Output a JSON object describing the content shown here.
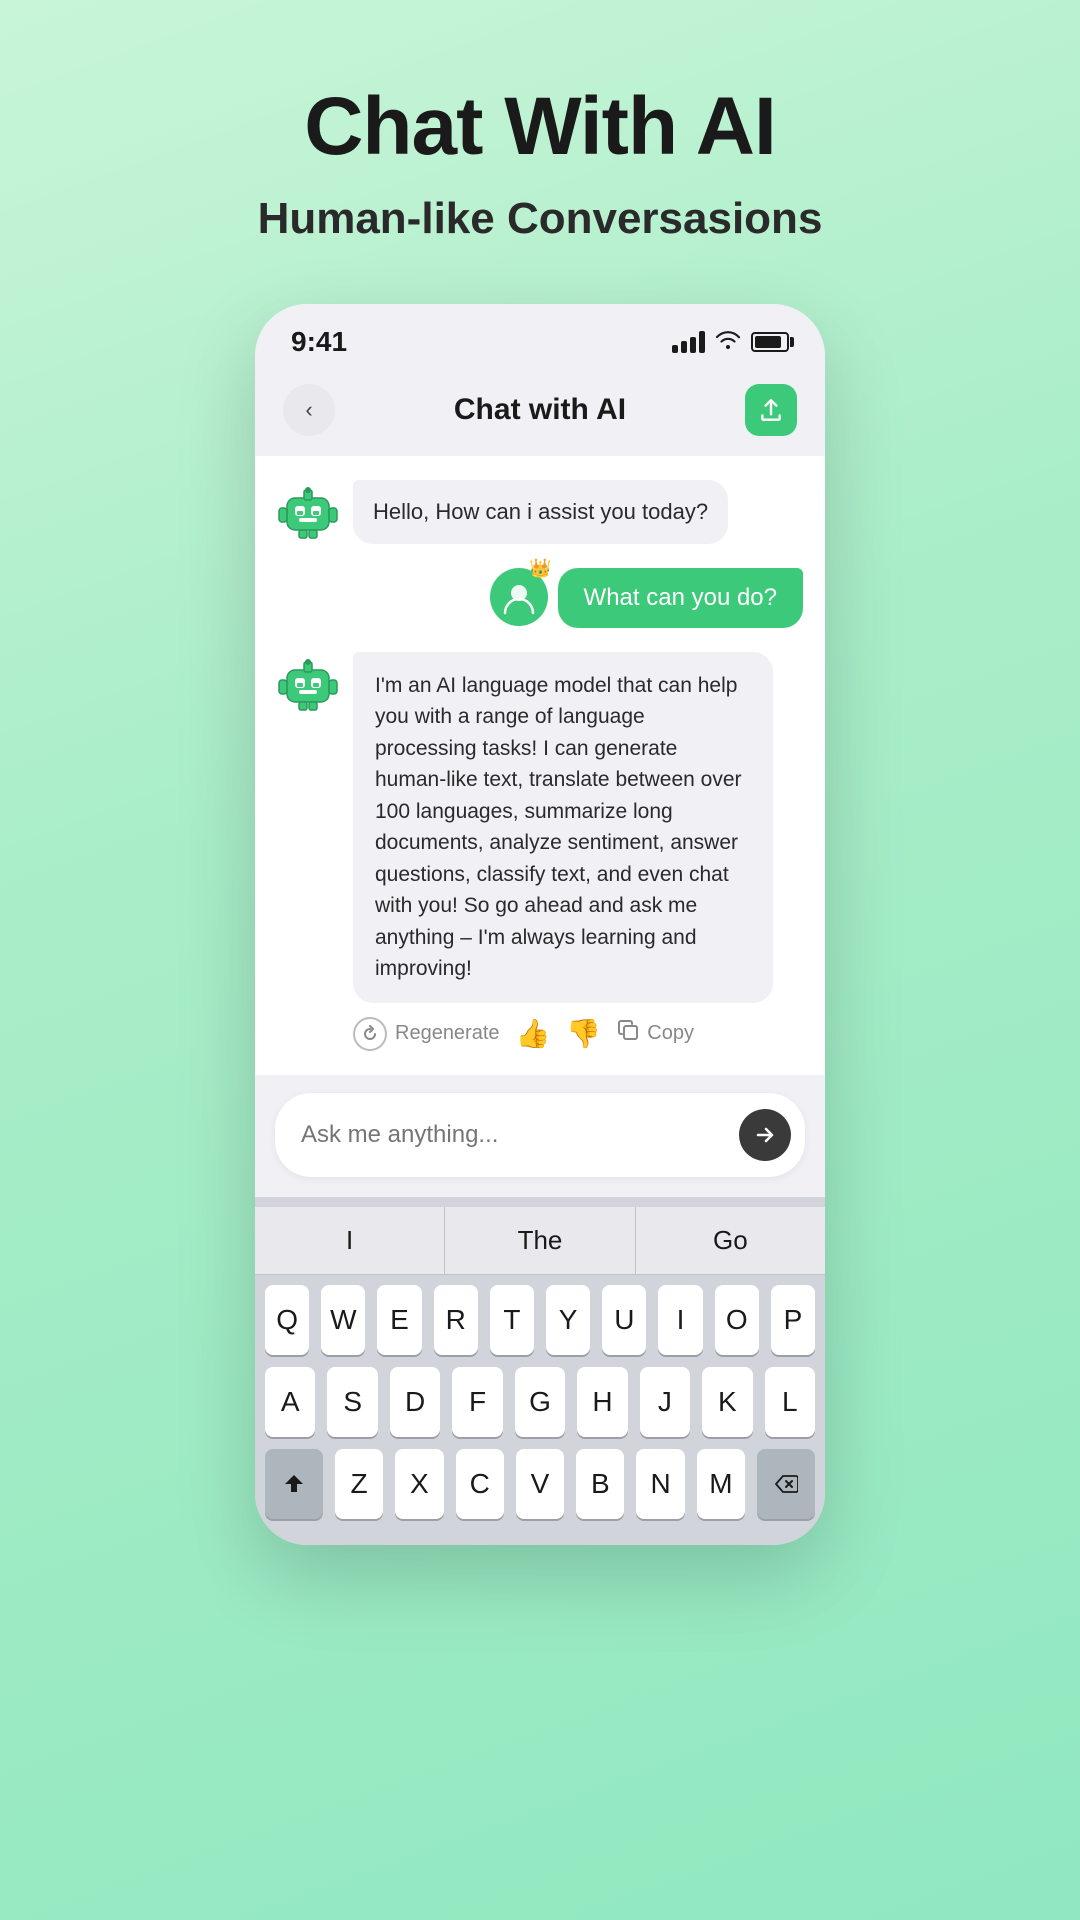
{
  "page": {
    "title": "Chat With AI",
    "subtitle": "Human-like Conversasions"
  },
  "status_bar": {
    "time": "9:41"
  },
  "header": {
    "title": "Chat with AI"
  },
  "messages": [
    {
      "type": "bot",
      "text": "Hello, How can i assist you today?"
    },
    {
      "type": "user",
      "text": "What can you do?"
    },
    {
      "type": "bot_long",
      "text": "I'm an AI language model that can help you with a range of language processing tasks! I can generate human-like text, translate between over 100 languages, summarize long documents, analyze sentiment, answer questions, classify text, and even chat with you! So go ahead and ask me anything – I'm always learning and improving!"
    }
  ],
  "actions": {
    "regenerate": "Regenerate",
    "copy": "Copy"
  },
  "input": {
    "placeholder": "Ask me anything..."
  },
  "keyboard": {
    "suggestions": [
      "I",
      "The",
      "Go"
    ],
    "row1": [
      "Q",
      "W",
      "E",
      "R",
      "T",
      "Y",
      "U",
      "I",
      "O",
      "P"
    ],
    "row2": [
      "A",
      "S",
      "D",
      "F",
      "G",
      "H",
      "J",
      "K",
      "L"
    ],
    "row3": [
      "Z",
      "X",
      "C",
      "V",
      "B",
      "N",
      "M"
    ]
  }
}
